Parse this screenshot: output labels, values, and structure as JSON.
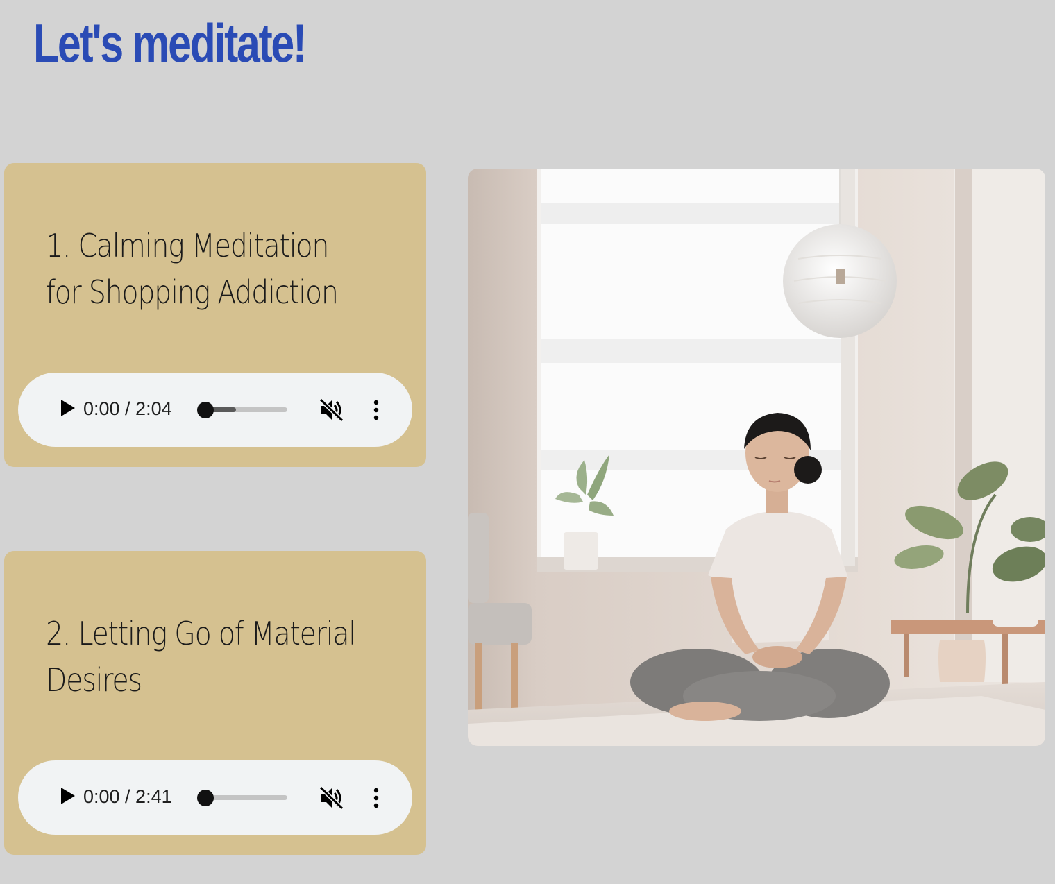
{
  "page": {
    "title": "Let's meditate!"
  },
  "meditations": [
    {
      "title": "1. Calming Meditation for Shopping Addiction",
      "player": {
        "time": "0:00 / 2:04",
        "progress_fraction": 0,
        "buffered_fraction": 0.37,
        "muted": true
      }
    },
    {
      "title": "2. Letting Go of Material Desires",
      "player": {
        "time": "0:00 / 2:41",
        "progress_fraction": 0,
        "buffered_fraction": 0,
        "muted": true
      }
    }
  ],
  "colors": {
    "background": "#d3d3d3",
    "title": "#2a4bb5",
    "card": "#d5c190",
    "player": "#f1f3f4"
  },
  "icons": {
    "play": "play-icon",
    "mute": "volume-muted-icon",
    "more": "more-vert-icon"
  }
}
